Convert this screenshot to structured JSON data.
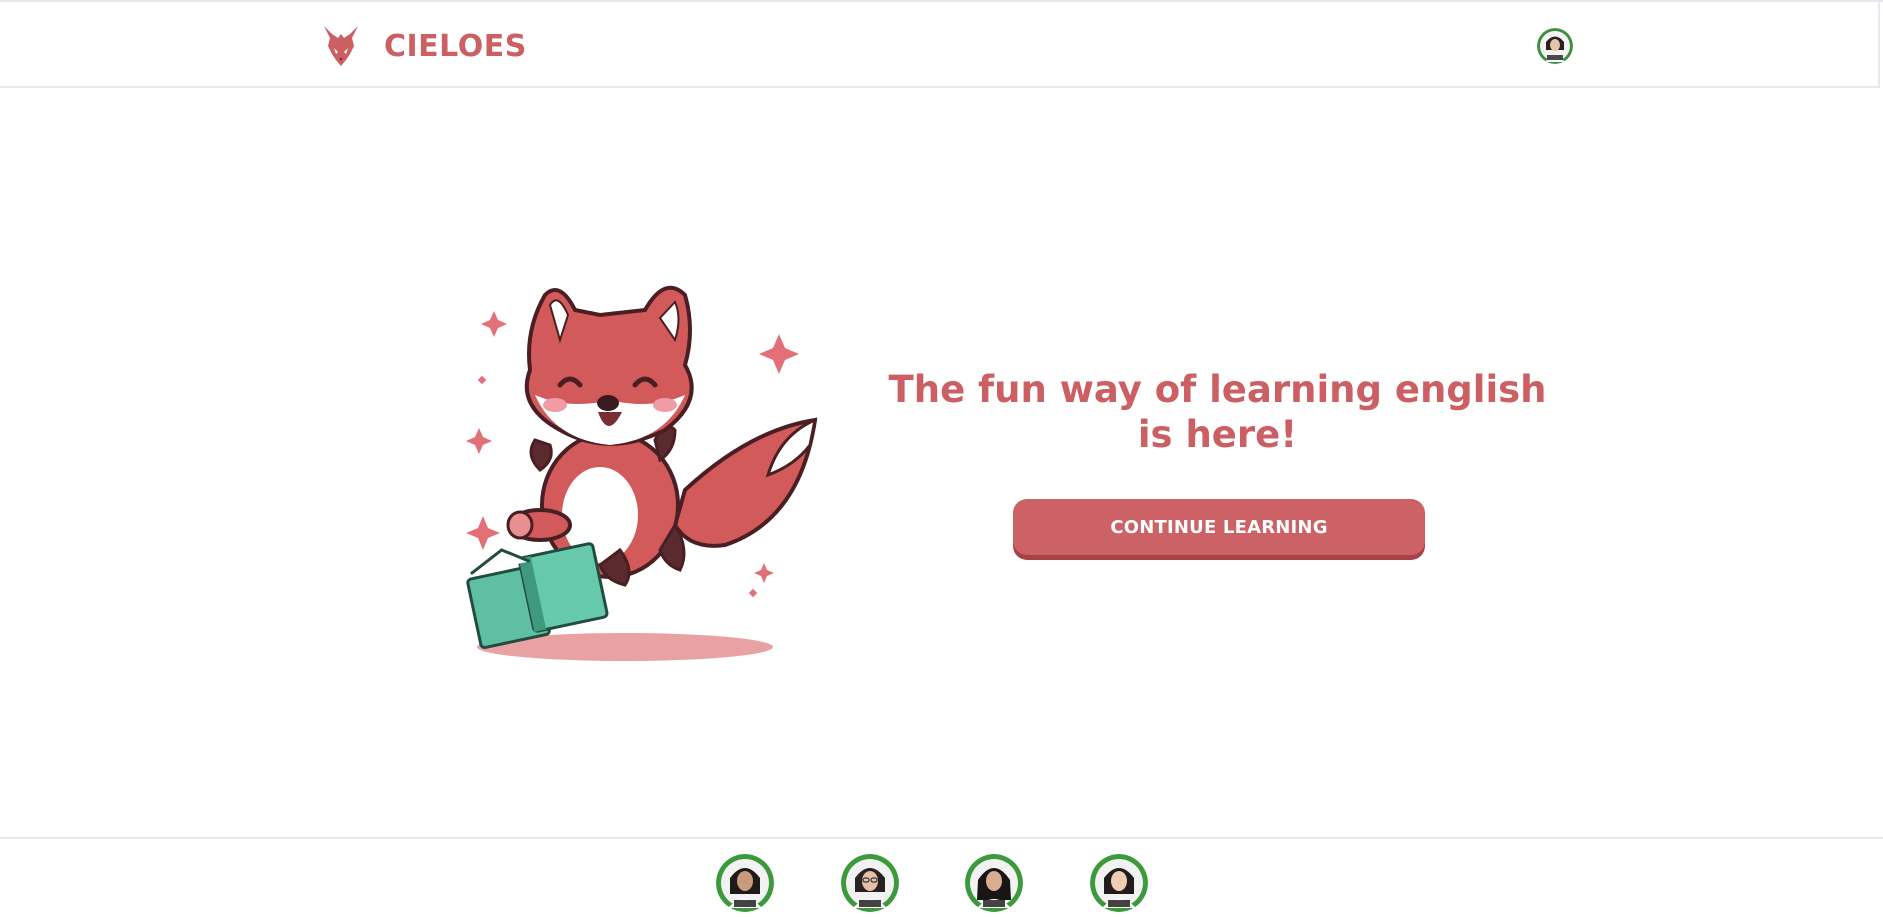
{
  "header": {
    "brand_name": "CIELOES",
    "logo_icon": "fox-head-icon",
    "profile_avatar_icon": "user-avatar-icon"
  },
  "main": {
    "hero_illustration": "fox-mascot-with-book",
    "tagline": "The fun way of learning english is here!",
    "cta_label": "CONTINUE LEARNING"
  },
  "footer": {
    "members": [
      {
        "avatar_icon": "team-member-avatar-icon"
      },
      {
        "avatar_icon": "team-member-avatar-icon"
      },
      {
        "avatar_icon": "team-member-avatar-icon"
      },
      {
        "avatar_icon": "team-member-avatar-icon"
      }
    ]
  },
  "colors": {
    "brand": "#cc5f63",
    "button": "#cc6166",
    "button_shadow": "#a94247",
    "book": "#5fbfa2",
    "avatar_ring": "#3c9a3c"
  }
}
